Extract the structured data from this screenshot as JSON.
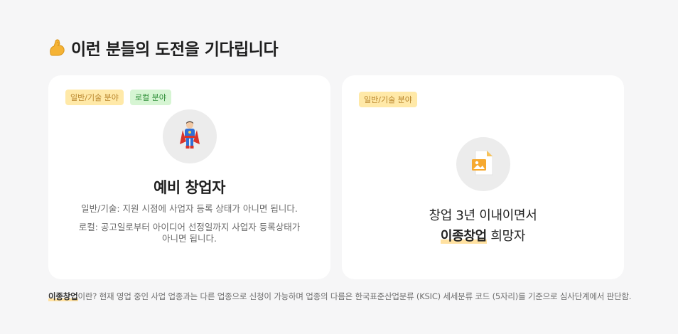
{
  "section": {
    "icon": "flexed-biceps-icon",
    "title": "이런 분들의 도전을 기다립니다"
  },
  "cards": [
    {
      "badges": [
        "일반/기술 분야",
        "로컬 분야"
      ],
      "avatar_icon": "superhero-icon",
      "title": "예비 창업자",
      "desc_general": "일반/기술: 지원 시점에 사업자 등록 상태가 아니면 됩니다.",
      "desc_local": "로컬: 공고일로부터 아이디어 선정일까지 사업자 등록상태가 아니면 됩니다."
    },
    {
      "badges": [
        "일반/기술 분야"
      ],
      "avatar_icon": "document-image-icon",
      "line1": "창업 3년 이내이면서",
      "highlight": "이종창업",
      "line2_rest": "희망자"
    }
  ],
  "footnote": {
    "highlight": "이종창업",
    "text": "이란? 현재 영업 중인 사업 업종과는 다른 업종으로 신청이 가능하며 업종의 다름은 한국표준산업분류 (KSIC) 세세분류 코드 (5자리)를 기준으로 심사단계에서 판단함."
  },
  "colors": {
    "background": "#f6f6f7",
    "card": "#ffffff",
    "badge_yellow_bg": "#ffe9a8",
    "badge_yellow_text": "#b8842a",
    "badge_green_bg": "#d6f5d3",
    "badge_green_text": "#2f8f38",
    "highlight": "#ffe1a0"
  }
}
